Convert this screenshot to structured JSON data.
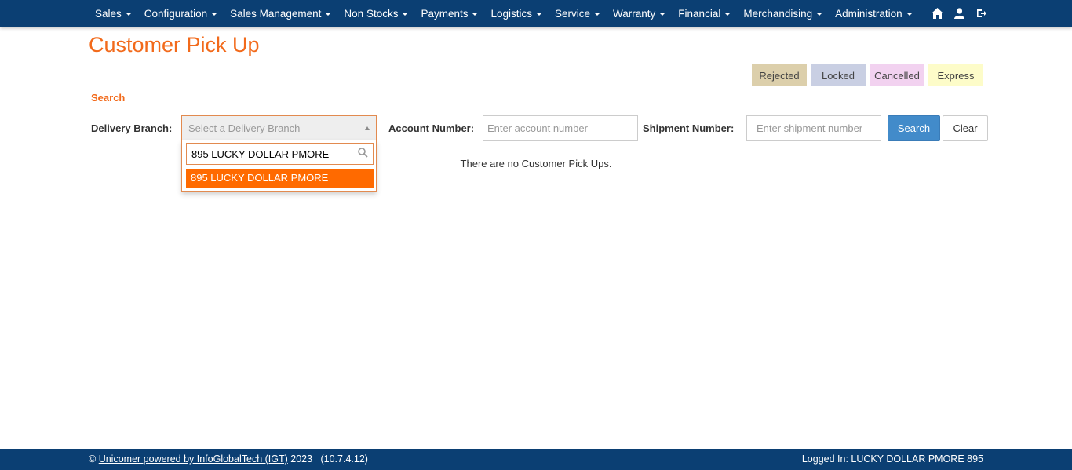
{
  "nav": {
    "items": [
      {
        "label": "Sales"
      },
      {
        "label": "Configuration"
      },
      {
        "label": "Sales Management"
      },
      {
        "label": "Non Stocks"
      },
      {
        "label": "Payments"
      },
      {
        "label": "Logistics"
      },
      {
        "label": "Service"
      },
      {
        "label": "Warranty"
      },
      {
        "label": "Financial"
      },
      {
        "label": "Merchandising"
      },
      {
        "label": "Administration"
      }
    ],
    "icons": [
      "home-icon",
      "user-icon",
      "logout-icon"
    ]
  },
  "page": {
    "title": "Customer Pick Up"
  },
  "legend": {
    "rejected": "Rejected",
    "locked": "Locked",
    "cancelled": "Cancelled",
    "express": "Express",
    "colors": {
      "rejected": "#dccfab",
      "locked": "#c9cfe3",
      "cancelled": "#f2d2f0",
      "express": "#fdfcc9"
    }
  },
  "search": {
    "section_title": "Search",
    "delivery_branch_label": "Delivery Branch:",
    "delivery_branch_placeholder": "Select a Delivery Branch",
    "dropdown_query": "895 LUCKY DOLLAR PMORE",
    "dropdown_option": "895 LUCKY DOLLAR PMORE",
    "account_label": "Account Number:",
    "account_placeholder": "Enter account number",
    "shipment_label": "Shipment Number:",
    "shipment_placeholder": "Enter shipment number",
    "search_button": "Search",
    "clear_button": "Clear"
  },
  "results": {
    "empty_message": "There are no Customer Pick Ups."
  },
  "footer": {
    "copyright": "©",
    "link_text": "Unicomer powered by InfoGlobalTech (IGT)",
    "year_version": "2023   (10.7.4.12)",
    "logged_in": "Logged In: LUCKY DOLLAR PMORE 895"
  },
  "theme": {
    "navbar": "#0b3f73",
    "accent": "#f26a1b",
    "primary_button": "#428bca",
    "highlight_option": "#ff6a00"
  }
}
